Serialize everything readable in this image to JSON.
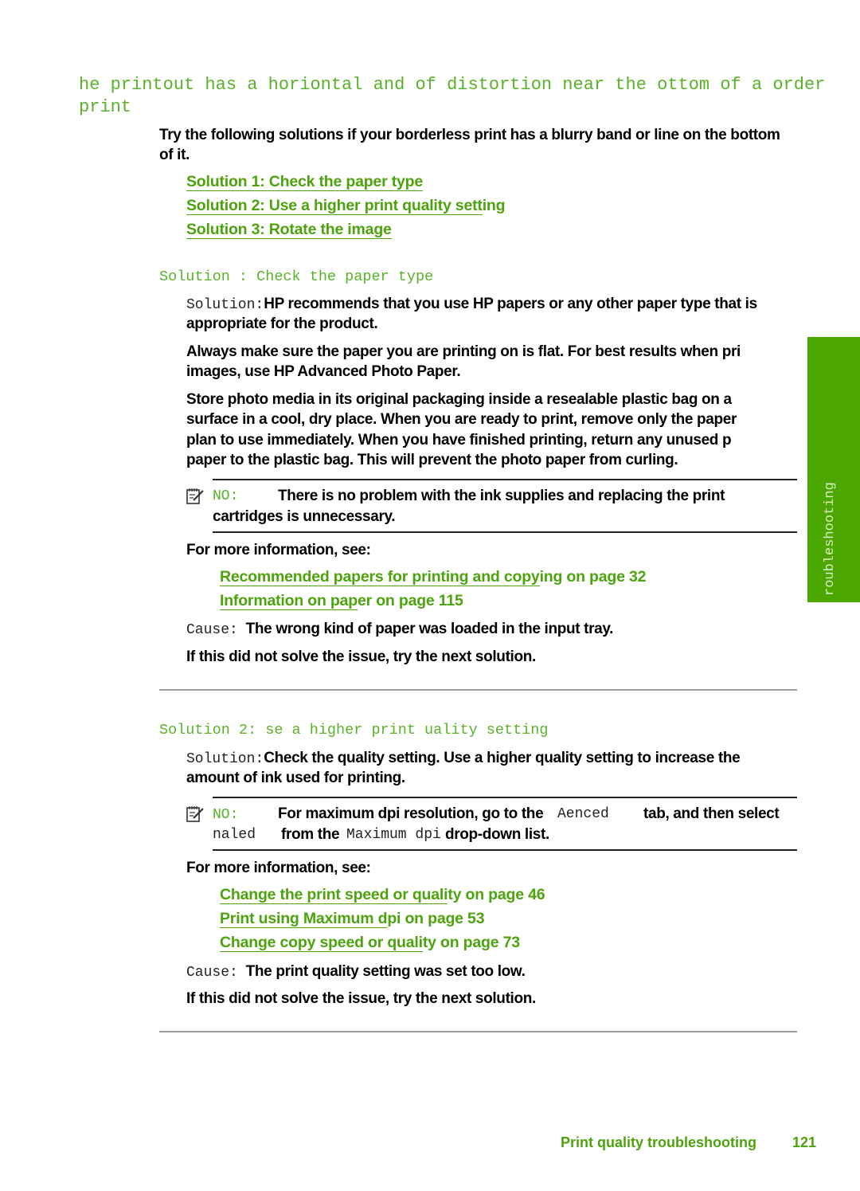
{
  "page": {
    "title_line1": "he printout has a horiontal and of distortion near the ottom of a order",
    "title_line2": "print",
    "intro_line1": "Try the following solutions if your borderless print has a blurry band or line on the bottom",
    "intro_line2": "of it.",
    "solution_links": [
      {
        "underlined": "Solution 1: Check the paper type",
        "rest": ""
      },
      {
        "underlined": "Solution 2: Use a higher print quality sett",
        "rest": "ing"
      },
      {
        "underlined": "Solution 3: Rotate the image",
        "rest": ""
      }
    ],
    "side_tab": {
      "label": "roubleshooting",
      "color": "#4ca800"
    },
    "footer": {
      "section": "Print quality troubleshooting",
      "page_number": "121"
    }
  },
  "solution1": {
    "heading": "Solution : Check the paper type",
    "solution_label": "Solution:",
    "solution_text_line1": "HP recommends that you use HP papers or any other paper type that is",
    "solution_text_line2": "appropriate for the product.",
    "para2_line1": "Always make sure the paper you are printing on is flat. For best results when pri",
    "para2_line2": "images, use HP Advanced Photo Paper.",
    "para3_lines": [
      "Store photo media in its original packaging inside a resealable plastic bag on a",
      "surface in a cool, dry place. When you are ready to print, remove only the paper",
      "plan to use immediately. When you have finished printing, return any unused p",
      "paper to the plastic bag. This will prevent the photo paper from curling."
    ],
    "note_label": "NO:",
    "note_line1": "There is no problem with the ink supplies and replacing the print",
    "note_line2": "cartridges is unnecessary.",
    "more_info": "For more information, see:",
    "links": [
      {
        "underlined": "Recommended papers for printing and copy",
        "rest": "ing on page 32"
      },
      {
        "underlined": "Information on pap",
        "rest": "er on page 115"
      }
    ],
    "cause_label": "Cause:",
    "cause_text": "The wrong kind of paper was loaded in the input tray.",
    "next": "If this did not solve the issue, try the next solution."
  },
  "solution2": {
    "heading": "Solution 2: se a higher print uality setting",
    "solution_label": "Solution:",
    "solution_text_line1": "Check the quality setting. Use a higher quality setting to increase the",
    "solution_text_line2": "amount of ink used for printing.",
    "note_label": "NO:",
    "note_part1": "For maximum dpi resolution, go to the",
    "note_mono1": "Aenced",
    "note_part2": "tab, and then select",
    "note_mono2": "naled",
    "note_part3": "from the",
    "note_mono3": "Maximum dpi",
    "note_part4": "drop-down list.",
    "more_info": "For more information, see:",
    "links": [
      {
        "underlined": "Change the print speed or quali",
        "rest": "ty on page 46"
      },
      {
        "underlined": "Print using Maximum d",
        "rest": "pi on page 53"
      },
      {
        "underlined": "Change copy speed or quali",
        "rest": "ty on page 73"
      }
    ],
    "cause_label": "Cause:",
    "cause_text": "The print quality setting was set too low.",
    "next": "If this did not solve the issue, try the next solution."
  }
}
